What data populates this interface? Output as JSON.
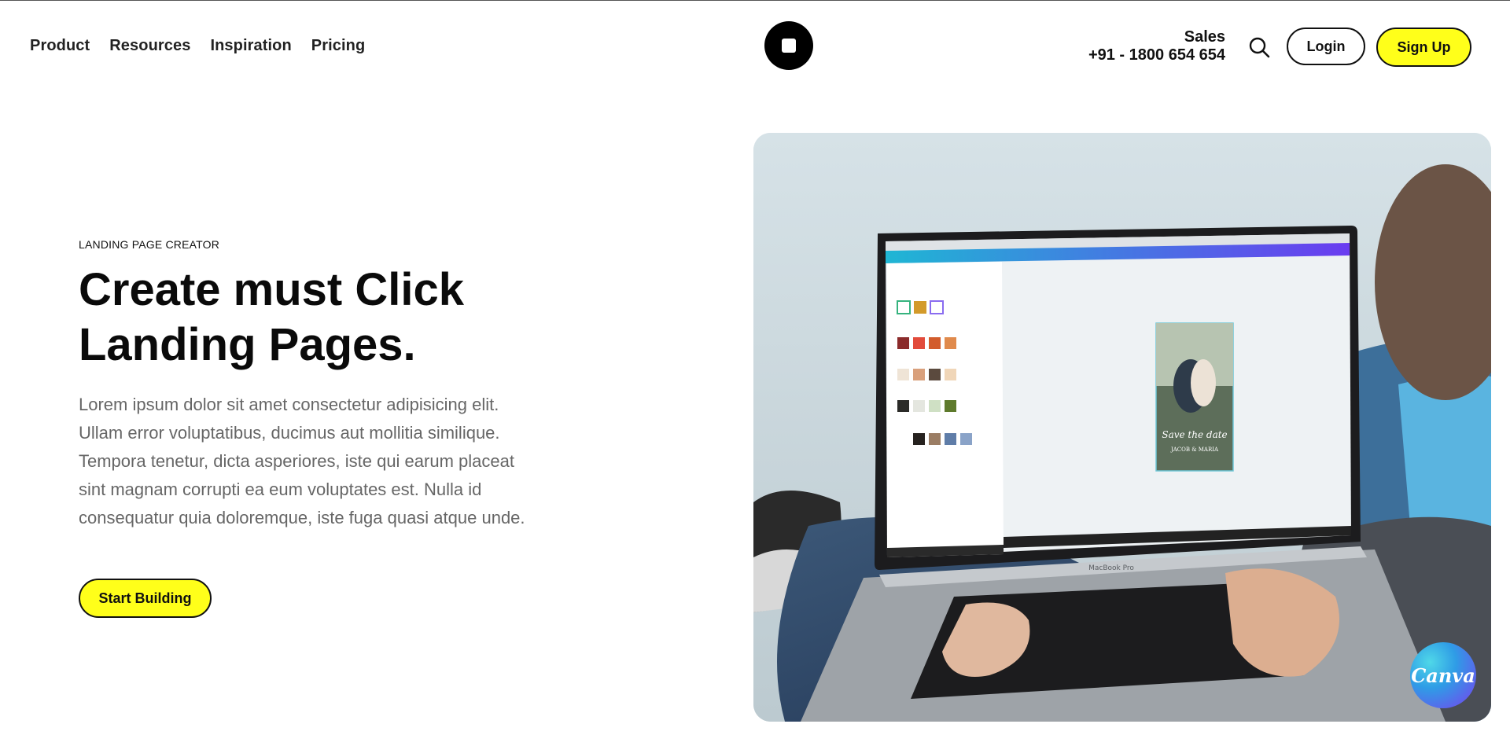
{
  "nav": {
    "links": [
      "Product",
      "Resources",
      "Inspiration",
      "Pricing"
    ],
    "sales_label": "Sales",
    "sales_phone": "+91 - 1800 654 654",
    "login_label": "Login",
    "signup_label": "Sign Up"
  },
  "hero": {
    "eyebrow": "LANDING PAGE CREATOR",
    "headline_line1": "Create must Click",
    "headline_line2": "Landing Pages.",
    "body": "Lorem ipsum dolor sit amet consectetur adipisicing elit. Ullam error voluptatibus, ducimus aut mollitia similique. Tempora tenetur, dicta asperiores, iste qui earum placeat sint magnam corrupti ea eum voluptates est. Nulla id consequatur quia doloremque, iste fuga quasi atque unde.",
    "cta_label": "Start Building"
  },
  "photo": {
    "laptop_brand": "MacBook Pro",
    "screen_card_title": "Save the date",
    "screen_card_names": "JACOB & MARIA",
    "badge_text": "Canva"
  },
  "colors": {
    "accent_yellow": "#ffff1a",
    "text_dark": "#111111",
    "body_gray": "#666666"
  }
}
